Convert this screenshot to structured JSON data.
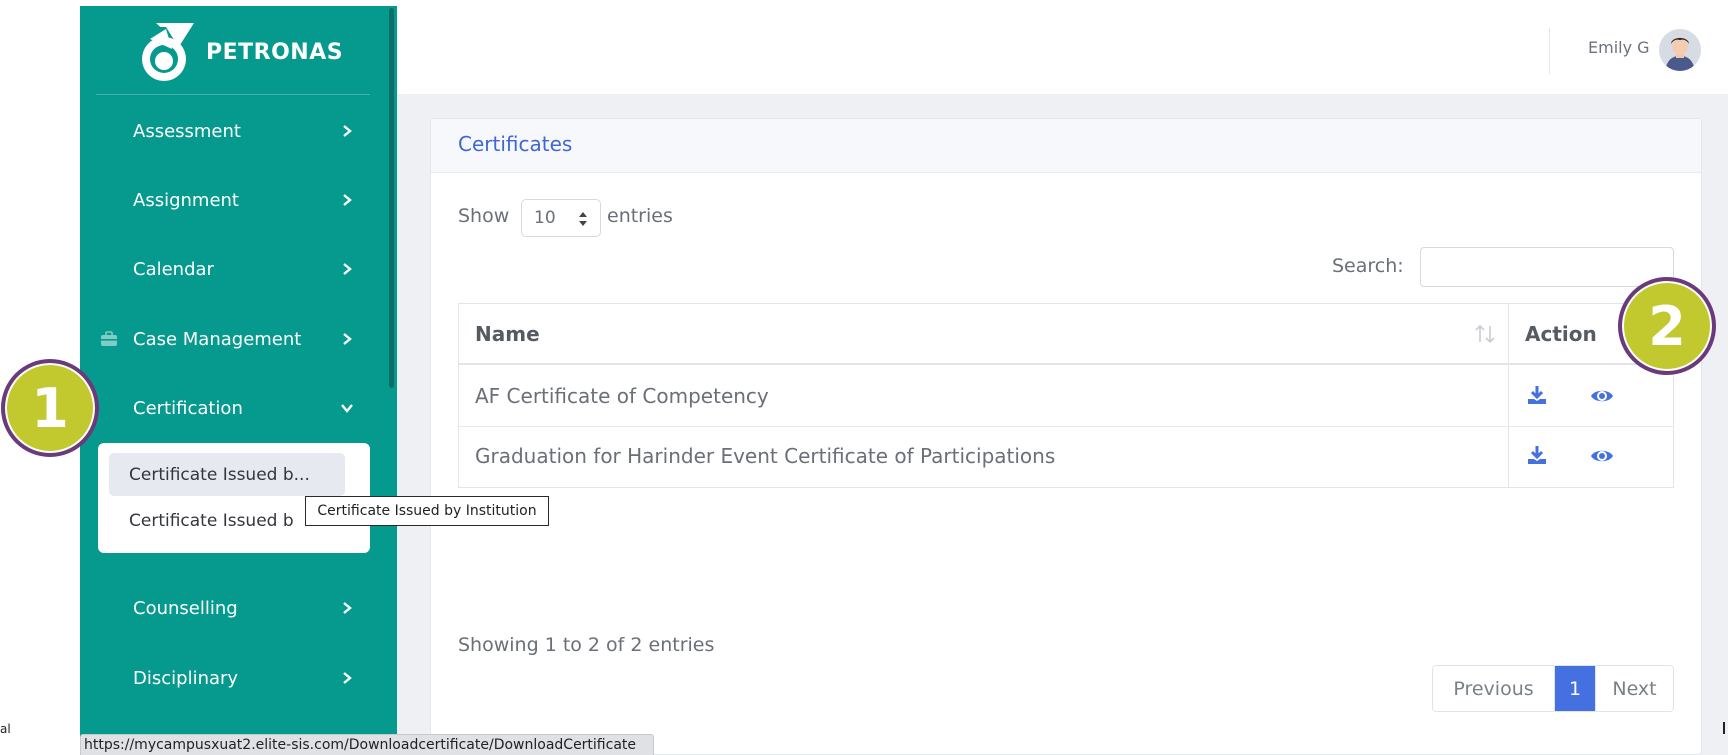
{
  "brand": {
    "name": "PETRONAS",
    "logo_icon": "petronas-logo-icon"
  },
  "sidebar": {
    "items": [
      {
        "label": "Assessment",
        "icon": "chevron-right-icon"
      },
      {
        "label": "Assignment",
        "icon": "chevron-right-icon"
      },
      {
        "label": "Calendar",
        "icon": "chevron-right-icon"
      },
      {
        "label": "Case Management",
        "icon": "chevron-right-icon",
        "lead_icon": "briefcase-icon"
      },
      {
        "label": "Certification",
        "icon": "chevron-down-icon",
        "expanded": true
      },
      {
        "label": "Counselling",
        "icon": "chevron-right-icon"
      },
      {
        "label": "Disciplinary",
        "icon": "chevron-right-icon"
      }
    ],
    "submenu": [
      {
        "label": "Certificate Issued b...",
        "active": true
      },
      {
        "label": "Certificate Issued b"
      }
    ],
    "tooltip": "Certificate Issued by Institution"
  },
  "topbar": {
    "user_name": "Emily G",
    "avatar_icon": "user-avatar-icon"
  },
  "card": {
    "title": "Certificates"
  },
  "table_controls": {
    "show_label": "Show",
    "page_length": "10",
    "entries_label": "entries",
    "search_label": "Search:",
    "search_value": ""
  },
  "table": {
    "headers": [
      "Name",
      "Action"
    ],
    "rows": [
      {
        "name": "AF Certificate of Competency",
        "actions": [
          "download-icon",
          "view-eye-icon"
        ]
      },
      {
        "name": "Graduation for Harinder Event Certificate of Participations",
        "actions": [
          "download-icon",
          "view-eye-icon"
        ]
      }
    ]
  },
  "footer": {
    "info": "Showing 1 to 2 of 2 entries",
    "pagination": {
      "previous": "Previous",
      "current": "1",
      "next": "Next"
    }
  },
  "status_bar": {
    "url": "https://mycampusxuat2.elite-sis.com/Downloadcertificate/DownloadCertificate"
  },
  "edge_text": "al",
  "annotations": {
    "step1": "1",
    "step2": "2"
  },
  "colors": {
    "sidebar": "#069a8e",
    "accent_blue": "#4470e0",
    "badge_fill": "#c2c92f",
    "badge_ring": "#6b3a7e"
  }
}
